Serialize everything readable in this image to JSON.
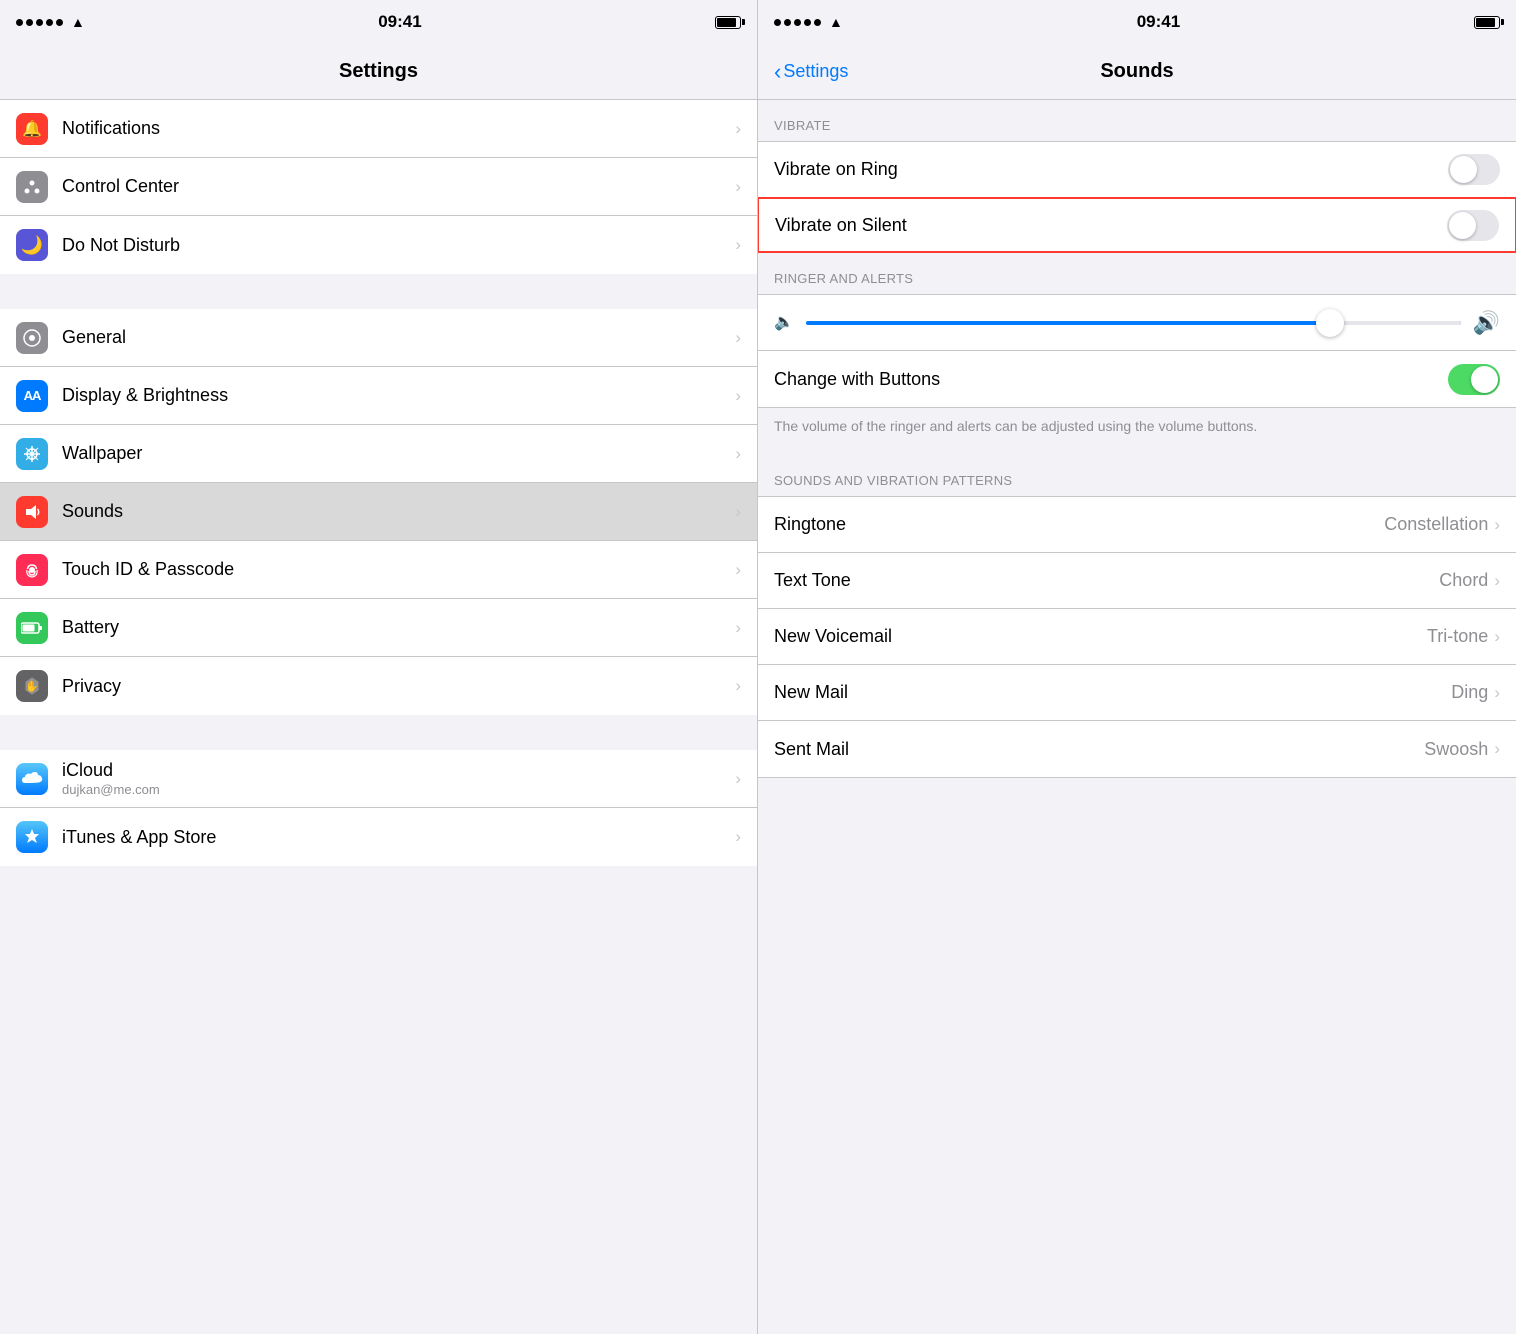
{
  "left": {
    "statusBar": {
      "time": "09:41",
      "dots": 5,
      "wifi": true,
      "battery": true
    },
    "navTitle": "Settings",
    "groups": [
      {
        "items": [
          {
            "id": "notifications",
            "iconClass": "red-icon",
            "iconChar": "🔔",
            "label": "Notifications",
            "sublabel": null
          },
          {
            "id": "control-center",
            "iconClass": "gray-icon",
            "iconChar": "⊞",
            "label": "Control Center",
            "sublabel": null
          },
          {
            "id": "do-not-disturb",
            "iconClass": "purple-icon",
            "iconChar": "🌙",
            "label": "Do Not Disturb",
            "sublabel": null
          }
        ]
      },
      {
        "items": [
          {
            "id": "general",
            "iconClass": "gray-icon",
            "iconChar": "⚙️",
            "label": "General",
            "sublabel": null
          },
          {
            "id": "display-brightness",
            "iconClass": "blue-icon",
            "iconChar": "AA",
            "label": "Display & Brightness",
            "sublabel": null
          },
          {
            "id": "wallpaper",
            "iconClass": "teal-icon",
            "iconChar": "❁",
            "label": "Wallpaper",
            "sublabel": null
          },
          {
            "id": "sounds",
            "iconClass": "red-icon",
            "iconChar": "🔊",
            "label": "Sounds",
            "sublabel": null,
            "highlighted": true
          },
          {
            "id": "touch-id-passcode",
            "iconClass": "pink-icon",
            "iconChar": "✋",
            "label": "Touch ID & Passcode",
            "sublabel": null
          },
          {
            "id": "battery",
            "iconClass": "green-icon",
            "iconChar": "🔋",
            "label": "Battery",
            "sublabel": null
          },
          {
            "id": "privacy",
            "iconClass": "dark-gray-icon",
            "iconChar": "✋",
            "label": "Privacy",
            "sublabel": null
          }
        ]
      },
      {
        "items": [
          {
            "id": "icloud",
            "iconClass": "icloud-icon",
            "iconChar": "☁",
            "label": "iCloud",
            "sublabel": "dujkan@me.com"
          },
          {
            "id": "itunes-appstore",
            "iconClass": "appstore-icon",
            "iconChar": "A",
            "label": "iTunes & App Store",
            "sublabel": null
          }
        ]
      }
    ]
  },
  "right": {
    "statusBar": {
      "time": "09:41"
    },
    "navBackLabel": "Settings",
    "navTitle": "Sounds",
    "sections": [
      {
        "id": "vibrate",
        "header": "VIBRATE",
        "rows": [
          {
            "id": "vibrate-ring",
            "label": "Vibrate on Ring",
            "type": "toggle",
            "value": false
          },
          {
            "id": "vibrate-silent",
            "label": "Vibrate on Silent",
            "type": "toggle",
            "value": false,
            "highlighted": true
          }
        ]
      },
      {
        "id": "ringer-alerts",
        "header": "RINGER AND ALERTS",
        "rows": [
          {
            "id": "volume-slider",
            "type": "slider"
          },
          {
            "id": "change-with-buttons",
            "label": "Change with Buttons",
            "type": "toggle",
            "value": true
          }
        ],
        "infoText": "The volume of the ringer and alerts can be adjusted using the volume buttons."
      },
      {
        "id": "sounds-vibration",
        "header": "SOUNDS AND VIBRATION PATTERNS",
        "rows": [
          {
            "id": "ringtone",
            "label": "Ringtone",
            "value": "Constellation"
          },
          {
            "id": "text-tone",
            "label": "Text Tone",
            "value": "Chord"
          },
          {
            "id": "new-voicemail",
            "label": "New Voicemail",
            "value": "Tri-tone"
          },
          {
            "id": "new-mail",
            "label": "New Mail",
            "value": "Ding"
          },
          {
            "id": "sent-mail",
            "label": "Sent Mail",
            "value": "Swoosh"
          }
        ]
      }
    ]
  }
}
